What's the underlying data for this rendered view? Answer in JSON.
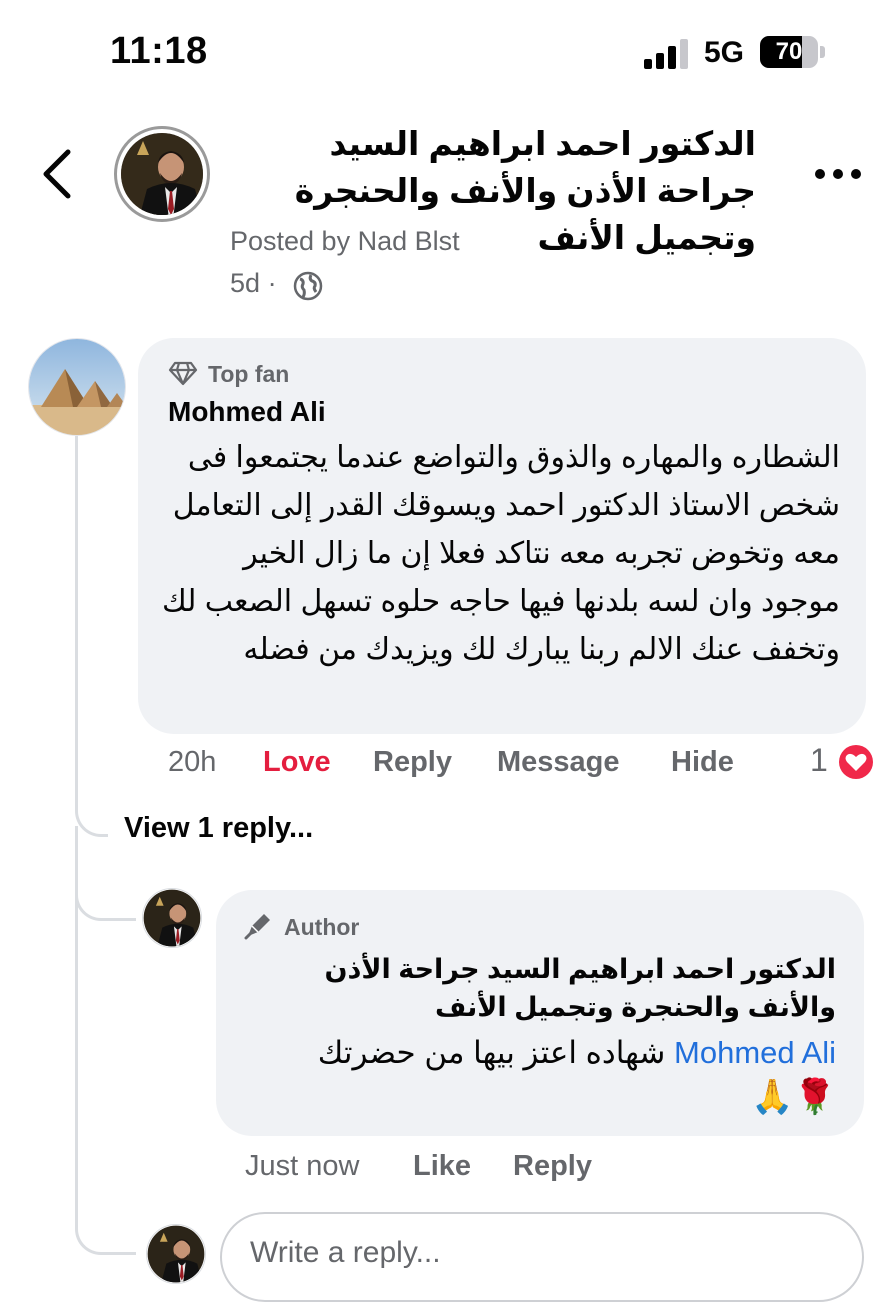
{
  "status_bar": {
    "time": "11:18",
    "network": "5G",
    "battery": "70"
  },
  "post": {
    "page_name": "الدكتور احمد ابراهيم السيد جراحة الأذن والأنف والحنجرة وتجميل الأنف",
    "posted_by": "Posted by Nad Blst",
    "time": "5d",
    "separator": "·"
  },
  "comment": {
    "badge": "Top fan",
    "author": "Mohmed Ali",
    "text": "الشطاره والمهاره والذوق والتواضع عندما يجتمعوا فى شخص الاستاذ الدكتور احمد ويسوقك القدر إلى التعامل معه وتخوض تجربه معه نتاكد فعلا إن ما زال الخير موجود وان لسه بلدنها فيها حاجه حلوه تسهل الصعب لك وتخفف عنك الالم ربنا يبارك لك ويزيدك من فضله",
    "time": "20h",
    "reaction_label": "Love",
    "reply_label": "Reply",
    "message_label": "Message",
    "hide_label": "Hide",
    "reaction_count": "1"
  },
  "view_replies": "View 1 reply...",
  "reply": {
    "badge": "Author",
    "author": "الدكتور احمد ابراهيم السيد جراحة الأذن والأنف والحنجرة وتجميل الأنف",
    "mention": "Mohmed Ali",
    "text": "شهاده اعتز بيها من حضرتك",
    "emojis": "🌹🙏",
    "time": "Just now",
    "like_label": "Like",
    "reply_label": "Reply"
  },
  "composer": {
    "placeholder": "Write a reply..."
  },
  "colors": {
    "love": "#e41e3f",
    "mention": "#216fdb",
    "muted": "#65676b",
    "bubble": "#f0f2f5"
  }
}
